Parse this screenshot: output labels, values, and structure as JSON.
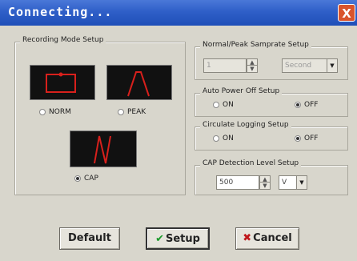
{
  "window": {
    "title": "Connecting...",
    "close_glyph": "X"
  },
  "recording": {
    "group_label": "Recording Mode Setup",
    "norm_label": "NORM",
    "peak_label": "PEAK",
    "cap_label": "CAP",
    "selected": "CAP"
  },
  "samplerate": {
    "group_label": "Normal/Peak Samprate Setup",
    "value": "1",
    "unit": "Second"
  },
  "autopower": {
    "group_label": "Auto Power Off Setup",
    "on_label": "ON",
    "off_label": "OFF",
    "selected": "OFF"
  },
  "circulate": {
    "group_label": "Circulate Logging Setup",
    "on_label": "ON",
    "off_label": "OFF",
    "selected": "OFF"
  },
  "cap": {
    "group_label": "CAP Detection Level Setup",
    "value": "500",
    "unit": "V"
  },
  "buttons": {
    "default_label": "Default",
    "setup_label": "Setup",
    "cancel_label": "Cancel"
  },
  "icons": {
    "setup": "check-icon",
    "cancel": "x-icon"
  },
  "colors": {
    "title_bar": "#2f5fc8",
    "wave_red": "#d8201c",
    "close_bg": "#d9542c",
    "setup_check": "#1a9a2a",
    "cancel_x": "#c0181c"
  }
}
